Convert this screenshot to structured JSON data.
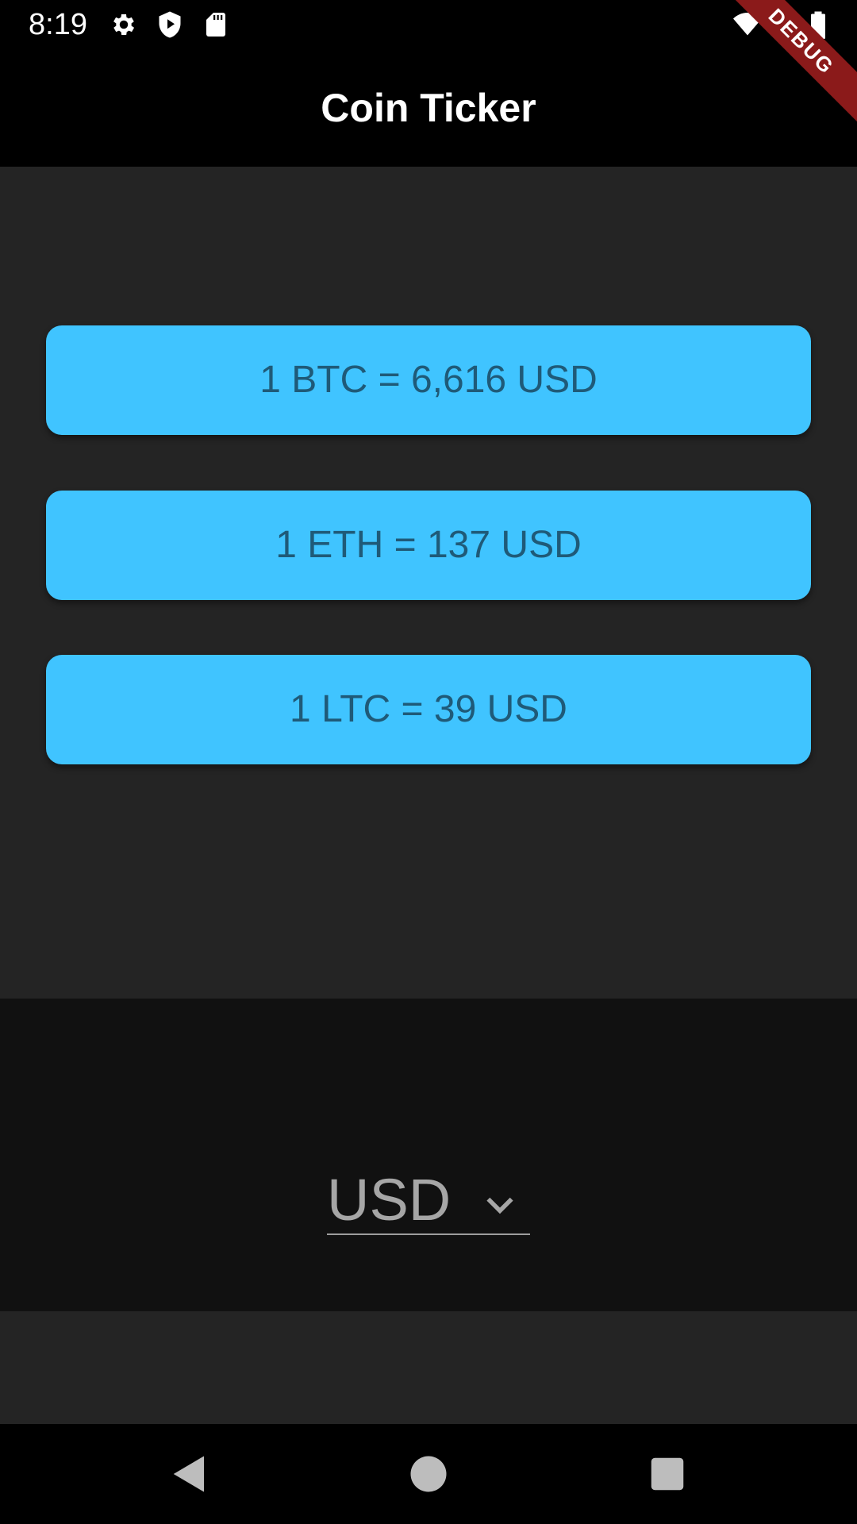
{
  "status_bar": {
    "time": "8:19",
    "left_icons": [
      "gear-icon",
      "shield-play-icon",
      "sd-card-icon"
    ],
    "right_icons": [
      "wifi-icon",
      "cellular-signal-icon",
      "battery-icon"
    ]
  },
  "debug_banner": {
    "label": "DEBUG",
    "color": "#8b1a1a"
  },
  "app_bar": {
    "title": "Coin Ticker"
  },
  "rates": [
    {
      "label": "1 BTC = 6,616 USD"
    },
    {
      "label": "1 ETH = 137 USD"
    },
    {
      "label": "1 LTC = 39 USD"
    }
  ],
  "currency_picker": {
    "selected": "USD",
    "icon": "chevron-down-icon"
  },
  "nav_bar": {
    "buttons": [
      "back-icon",
      "home-icon",
      "recents-icon"
    ]
  },
  "colors": {
    "card": "#40c4ff",
    "card_text": "#1f5a78",
    "background": "#242424",
    "picker_background": "#111111",
    "app_bar": "#000000"
  }
}
